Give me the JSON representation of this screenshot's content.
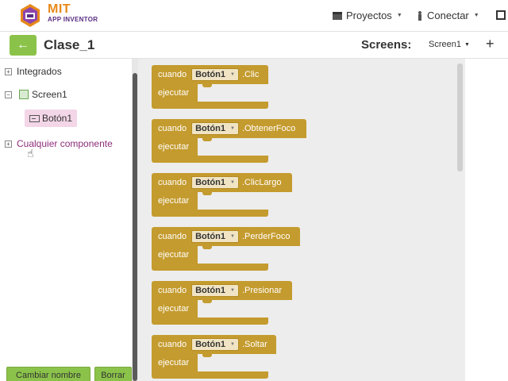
{
  "app": {
    "logo_title": "MIT",
    "logo_subtitle": "APP INVENTOR"
  },
  "nav": {
    "projects": "Proyectos",
    "connect": "Conectar"
  },
  "toolbar": {
    "back_icon": "arrow-left-icon",
    "project_name": "Clase_1",
    "screens_label": "Screens:",
    "screen_selected": "Screen1",
    "add_screen": "+"
  },
  "tree": {
    "integrados": "Integrados",
    "screen": "Screen1",
    "boton": "Botón1",
    "any_component": "Cualquier componente",
    "rename_button": "Cambiar nombre",
    "delete_button": "Borrar"
  },
  "blocks": [
    {
      "when": "cuando",
      "component": "Botón1",
      "event": ".Clic",
      "do": "ejecutar"
    },
    {
      "when": "cuando",
      "component": "Botón1",
      "event": ".ObtenerFoco",
      "do": "ejecutar"
    },
    {
      "when": "cuando",
      "component": "Botón1",
      "event": ".ClicLargo",
      "do": "ejecutar"
    },
    {
      "when": "cuando",
      "component": "Botón1",
      "event": ".PerderFoco",
      "do": "ejecutar"
    },
    {
      "when": "cuando",
      "component": "Botón1",
      "event": ".Presionar",
      "do": "ejecutar"
    },
    {
      "when": "cuando",
      "component": "Botón1",
      "event": ".Soltar",
      "do": "ejecutar"
    }
  ],
  "colors": {
    "accent_green": "#8bc34a",
    "block_event": "#c49b2e",
    "any_component_text": "#8e2d7a",
    "logo_orange": "#e6891a"
  }
}
